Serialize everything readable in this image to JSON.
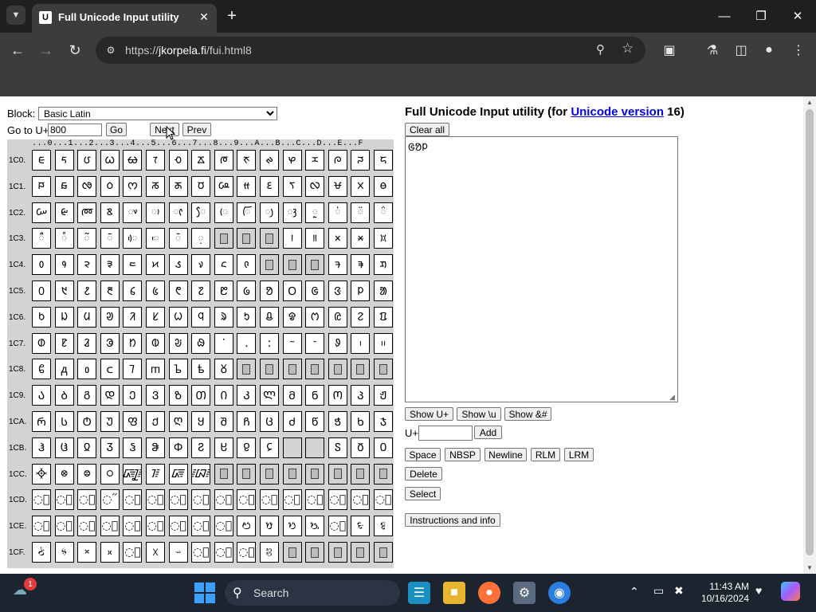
{
  "browser": {
    "tab_title": "Full Unicode Input utility",
    "tab_favicon": "U",
    "url_prefix": "https://",
    "url_host": "jkorpela.fi",
    "url_path": "/fui.html8"
  },
  "left": {
    "block_label": "Block:",
    "block_selected": "Basic Latin",
    "goto_label": "Go to U+",
    "goto_value": "800",
    "go_button": "Go",
    "next_button": "Next",
    "prev_button": "Prev"
  },
  "grid": {
    "column_header": "...0...1...2...3...4...5...6...7...8...9...A...B...C...D...E...F",
    "row_labels": [
      "1C0.",
      "1C1.",
      "1C2.",
      "1C3.",
      "1C4.",
      "1C5.",
      "1C6.",
      "1C7.",
      "1C8.",
      "1C9.",
      "1CA.",
      "1CB.",
      "1CC.",
      "1CD.",
      "1CE.",
      "1CF."
    ],
    "rows": [
      [
        "ᰀ",
        "ᰁ",
        "ᰂ",
        "ᰃ",
        "ᰄ",
        "ᰅ",
        "ᰆ",
        "ᰇ",
        "ᰈ",
        "ᰉ",
        "ᰊ",
        "ᰋ",
        "ᰌ",
        "ᰍ",
        "ᰎ",
        "ᰏ"
      ],
      [
        "ᰐ",
        "ᰑ",
        "ᰒ",
        "ᰓ",
        "ᰔ",
        "ᰕ",
        "ᰖ",
        "ᰗ",
        "ᰘ",
        "ᰙ",
        "ᰚ",
        "ᰛ",
        "ᰜ",
        "ᰝ",
        "ᰞ",
        "ᰟ"
      ],
      [
        "ᰠ",
        "ᰡ",
        "ᰢ",
        "ᰣ",
        "◌ᰤ",
        "◌ᰥ",
        "◌ᰦ",
        "◌ᰧ",
        "◌ᰨ",
        "◌ᰩ",
        "◌ᰪ",
        "◌ᰫ",
        "◌ᰬ",
        "◌ᰭ",
        "◌ᰮ",
        "◌ᰯ"
      ],
      [
        "◌ᰰ",
        "◌ᰱ",
        "◌ᰲ",
        "◌ᰳ",
        "◌ᰴ",
        "◌ᰵ",
        "◌ᰶ",
        "◌᰷",
        "",
        "",
        "",
        "᰻",
        "᰼",
        "᰽",
        "᰾",
        "᰿"
      ],
      [
        "᱀",
        "᱁",
        "᱂",
        "᱃",
        "᱄",
        "᱅",
        "᱆",
        "᱇",
        "᱈",
        "᱉",
        "",
        "",
        "",
        "ᱍ",
        "ᱎ",
        "ᱏ"
      ],
      [
        "᱐",
        "᱑",
        "᱒",
        "᱓",
        "᱔",
        "᱕",
        "᱖",
        "᱗",
        "᱘",
        "᱙",
        "ᱚ",
        "ᱛ",
        "ᱜ",
        "ᱝ",
        "ᱞ",
        "ᱟ"
      ],
      [
        "ᱠ",
        "ᱡ",
        "ᱢ",
        "ᱣ",
        "ᱤ",
        "ᱥ",
        "ᱦ",
        "ᱧ",
        "ᱨ",
        "ᱩ",
        "ᱪ",
        "ᱫ",
        "ᱬ",
        "ᱭ",
        "ᱮ",
        "ᱯ"
      ],
      [
        "ᱰ",
        "ᱱ",
        "ᱲ",
        "ᱳ",
        "ᱴ",
        "ᱵ",
        "ᱶ",
        "ᱷ",
        "ᱸ",
        "ᱹ",
        "ᱺ",
        "ᱻ",
        "ᱼ",
        "ᱽ",
        "᱾",
        "᱿"
      ],
      [
        "ᲀ",
        "ᲁ",
        "ᲂ",
        "ᲃ",
        "ᲄ",
        "ᲅ",
        "ᲆ",
        "ᲇ",
        "ᲈ",
        "",
        "",
        "",
        "",
        "",
        "",
        ""
      ],
      [
        "Ა",
        "Ბ",
        "Გ",
        "Დ",
        "Ე",
        "Ვ",
        "Ზ",
        "Თ",
        "Ი",
        "Კ",
        "Ლ",
        "Მ",
        "Ნ",
        "Ო",
        "Პ",
        "Ჟ"
      ],
      [
        "Რ",
        "Ს",
        "Ტ",
        "Უ",
        "Ფ",
        "Ქ",
        "Ღ",
        "Ყ",
        "Შ",
        "Ჩ",
        "Ც",
        "Ძ",
        "Წ",
        "Ჭ",
        "Ხ",
        "Ჯ"
      ],
      [
        "Ჰ",
        "Ჱ",
        "Ჲ",
        "Ჳ",
        "Ჴ",
        "Ჵ",
        "Ჶ",
        "Ჷ",
        "Ჸ",
        "Ჹ",
        "Ჺ",
        "",
        "",
        "Ჽ",
        "Ჾ",
        "Ჿ"
      ],
      [
        "᳀",
        "᳁",
        "᳂",
        "᳃",
        "᳄",
        "᳅",
        "᳆",
        "᳇",
        "",
        "",
        "",
        "",
        "",
        "",
        "",
        ""
      ],
      [
        "◌᳐",
        "◌᳑",
        "◌᳒",
        "◌᳓",
        "◌᳔",
        "◌᳕",
        "◌᳖",
        "◌᳗",
        "◌᳘",
        "◌᳙",
        "◌᳚",
        "◌᳛",
        "◌᳜",
        "◌᳝",
        "◌᳞",
        "◌᳟"
      ],
      [
        "◌᳠",
        "◌᳡",
        "◌᳢",
        "◌᳣",
        "◌᳤",
        "◌᳥",
        "◌᳦",
        "◌᳧",
        "◌᳨",
        "ᳩ",
        "ᳪ",
        "ᳫ",
        "ᳬ",
        "◌᳭",
        "ᳮ",
        "ᳯ"
      ],
      [
        "ᳰ",
        "ᳱ",
        "ᳲ",
        "ᳳ",
        "◌᳴",
        "ᳵ",
        "ᳶ",
        "◌᳷",
        "◌᳸",
        "◌᳹",
        "ᳺ",
        "",
        "",
        "",
        "",
        ""
      ]
    ],
    "unassigned": [
      [
        3,
        8
      ],
      [
        3,
        9
      ],
      [
        3,
        10
      ],
      [
        4,
        10
      ],
      [
        4,
        11
      ],
      [
        4,
        12
      ],
      [
        8,
        9
      ],
      [
        8,
        10
      ],
      [
        8,
        11
      ],
      [
        8,
        12
      ],
      [
        8,
        13
      ],
      [
        8,
        14
      ],
      [
        8,
        15
      ],
      [
        11,
        11
      ],
      [
        11,
        12
      ],
      [
        12,
        8
      ],
      [
        12,
        9
      ],
      [
        12,
        10
      ],
      [
        12,
        11
      ],
      [
        12,
        12
      ],
      [
        12,
        13
      ],
      [
        12,
        14
      ],
      [
        12,
        15
      ],
      [
        15,
        11
      ],
      [
        15,
        12
      ],
      [
        15,
        13
      ],
      [
        15,
        14
      ],
      [
        15,
        15
      ]
    ],
    "tofu": [
      [
        3,
        8
      ],
      [
        3,
        9
      ],
      [
        3,
        10
      ],
      [
        4,
        10
      ],
      [
        4,
        11
      ],
      [
        4,
        12
      ],
      [
        8,
        9
      ],
      [
        8,
        10
      ],
      [
        8,
        11
      ],
      [
        8,
        12
      ],
      [
        8,
        13
      ],
      [
        8,
        14
      ],
      [
        8,
        15
      ],
      [
        12,
        8
      ],
      [
        12,
        9
      ],
      [
        12,
        10
      ],
      [
        12,
        11
      ],
      [
        12,
        12
      ],
      [
        12,
        13
      ],
      [
        12,
        14
      ],
      [
        12,
        15
      ],
      [
        15,
        11
      ],
      [
        15,
        12
      ],
      [
        15,
        13
      ],
      [
        15,
        14
      ],
      [
        15,
        15
      ]
    ]
  },
  "right": {
    "title_prefix": "Full Unicode Input utility (for ",
    "title_link": "Unicode version",
    "title_suffix": " 16)",
    "clear_all": "Clear all",
    "text_value": "ᱜᱚᱞ",
    "show_uplus": "Show U+",
    "show_backslash_u": "Show \\u",
    "show_amp": "Show &#",
    "uplus_label": "U+",
    "uplus_value": "",
    "add_button": "Add",
    "space_button": "Space",
    "nbsp_button": "NBSP",
    "newline_button": "Newline",
    "rlm_button": "RLM",
    "lrm_button": "LRM",
    "delete_button": "Delete",
    "select_button": "Select",
    "instructions_button": "Instructions and info"
  },
  "taskbar": {
    "badge": "1",
    "search_placeholder": "Search",
    "time": "11:43 AM",
    "date": "10/16/2024"
  }
}
